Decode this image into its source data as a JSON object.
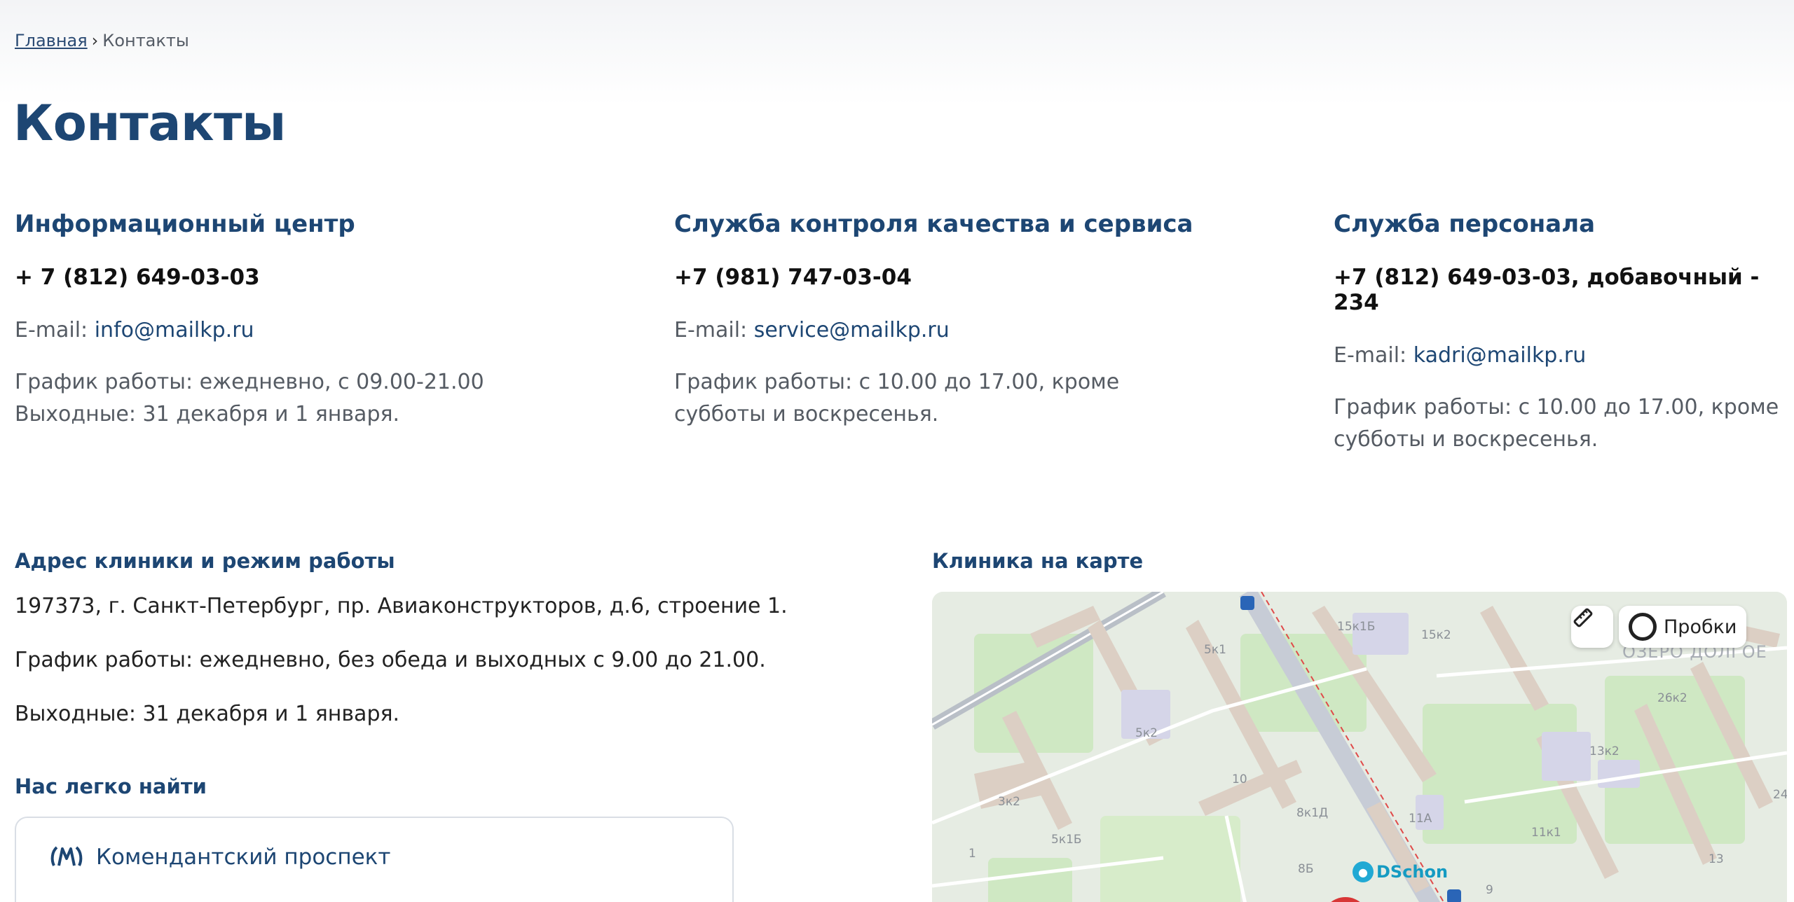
{
  "breadcrumb": {
    "home": "Главная",
    "separator": "›",
    "current": "Контакты"
  },
  "page_title": "Контакты",
  "columns": [
    {
      "title": "Информационный центр",
      "phone": "+ 7 (812) 649-03-03",
      "email_label": "E-mail:",
      "email": "info@mailkp.ru",
      "schedule_line1": "График работы: ежедневно, с 09.00-21.00",
      "schedule_line2": "Выходные: 31 декабря и 1 января."
    },
    {
      "title": "Служба контроля качества и сервиса",
      "phone": "+7 (981) 747-03-04",
      "email_label": "E-mail:",
      "email": "service@mailkp.ru",
      "schedule_line1": "График работы: с 10.00 до 17.00, кроме",
      "schedule_line2": "субботы и воскресенья."
    },
    {
      "title": "Служба персонала",
      "phone": "+7 (812) 649-03-03, добавочный - 234",
      "email_label": "E-mail:",
      "email": "kadri@mailkp.ru",
      "schedule_line1": "График работы: с 10.00 до 17.00, кроме",
      "schedule_line2": "субботы и воскресенья."
    }
  ],
  "address_section": {
    "title": "Адрес клиники и режим работы",
    "address": "197373, г. Санкт-Петербург, пр. Авиаконструкторов, д.6, строение 1.",
    "schedule": "График работы: ежедневно, без обеда и выходных с 9.00 до 21.00.",
    "days_off": "Выходные: 31 декабря и 1 января."
  },
  "find_section": {
    "title": "Нас легко найти",
    "metro_station": "Комендантский проспект"
  },
  "map_section": {
    "title": "Клиника на карте",
    "traffic_label": "Пробки",
    "poi_label": "DSchon",
    "area_label": "ОЗЕРО ДОЛГОЕ",
    "house_labels": [
      "15к1Б",
      "15к2",
      "5к1",
      "5к2",
      "26к2",
      "13к2",
      "10",
      "3к2",
      "8к1Д",
      "11А",
      "11к1",
      "5к1Б",
      "1",
      "8Б",
      "13",
      "9",
      "24"
    ]
  },
  "colors": {
    "primary": "#1d4673",
    "metro_blue": "#1d4673",
    "poi": "#21a9d4"
  }
}
